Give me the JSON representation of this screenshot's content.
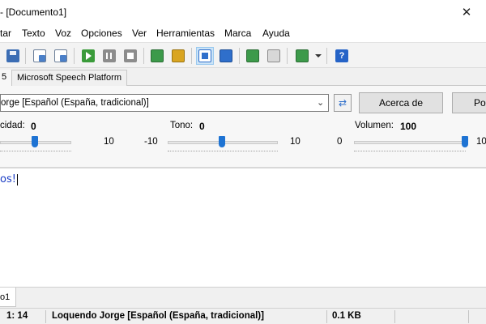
{
  "window": {
    "title": "- [Documento1]"
  },
  "menu": [
    "tar",
    "Texto",
    "Voz",
    "Opciones",
    "Ver",
    "Herramientas",
    "Marca",
    "Ayuda"
  ],
  "voice_tabs": {
    "first": "5",
    "second": "Microsoft Speech Platform"
  },
  "voice": {
    "selected": "orge [Español (España, tradicional)]",
    "about_label": "Acerca de",
    "second_button_label": "Por"
  },
  "sliders": {
    "speed": {
      "label": "cidad:",
      "value": "0",
      "max_label": "10",
      "level": 0.5
    },
    "pitch": {
      "label": "Tono:",
      "value": "0",
      "min_label": "-10",
      "max_label": "10",
      "level": 0.5
    },
    "volume": {
      "label": "Volumen:",
      "value": "100",
      "min_label": "0",
      "max_label": "10",
      "level": 1.0
    }
  },
  "editor": {
    "text": "os!"
  },
  "doc_tab": {
    "label": "o1"
  },
  "status": {
    "position": "1:  14",
    "voice": "Loquendo Jorge [Español (España, tradicional)]",
    "size": "0.1 KB"
  },
  "colors": {
    "accent": "#1e73d3",
    "editor_text": "#1a3cc4"
  },
  "icons": [
    "save-icon",
    "open-doc-icon",
    "open-doc2-icon",
    "play-icon",
    "pause-icon",
    "stop-icon",
    "book-green-icon",
    "book-yellow-icon",
    "edit-icon",
    "read-icon",
    "voice-green-icon",
    "voice-gray-icon",
    "speech-icon",
    "help-icon"
  ]
}
